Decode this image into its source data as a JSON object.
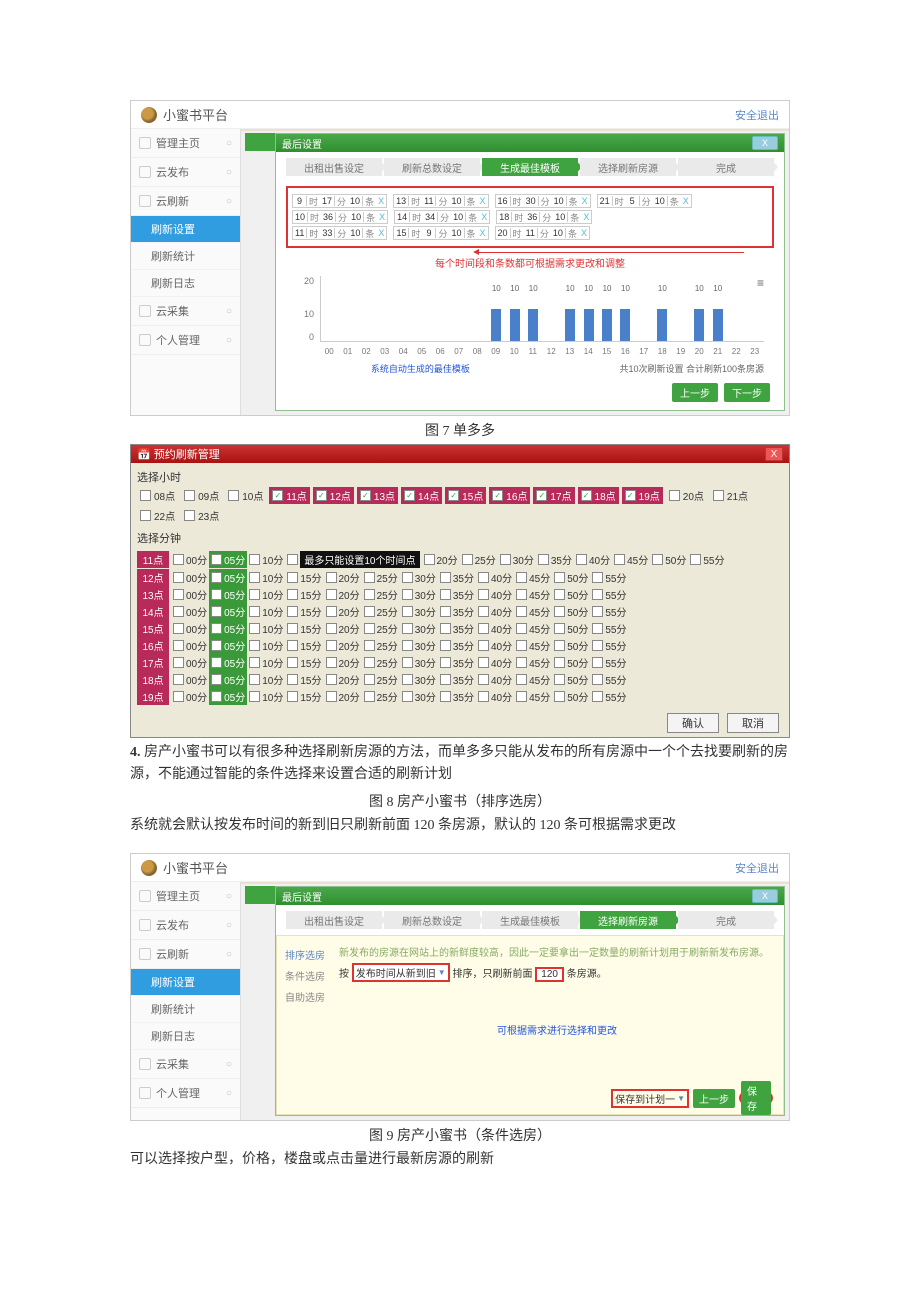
{
  "platform": {
    "name": "小蜜书平台",
    "safe_exit": "安全退出"
  },
  "sidebar": {
    "items": [
      {
        "label": "管理主页"
      },
      {
        "label": "云发布"
      },
      {
        "label": "云刷新"
      },
      {
        "label": "云采集"
      },
      {
        "label": "个人管理"
      }
    ],
    "sub": [
      "刷新设置",
      "刷新统计",
      "刷新日志"
    ]
  },
  "dialog1": {
    "title": "最后设置",
    "steps": [
      "出租出售设定",
      "刷新总数设定",
      "生成最佳模板",
      "选择刷新房源",
      "完成"
    ],
    "active_step": 2,
    "times": [
      [
        {
          "h": "9",
          "m": "17",
          "c": "10"
        },
        {
          "h": "13",
          "m": "11",
          "c": "10"
        },
        {
          "h": "16",
          "m": "30",
          "c": "10"
        },
        {
          "h": "21",
          "m": "5",
          "c": "10"
        }
      ],
      [
        {
          "h": "10",
          "m": "36",
          "c": "10"
        },
        {
          "h": "14",
          "m": "34",
          "c": "10"
        },
        {
          "h": "18",
          "m": "36",
          "c": "10"
        }
      ],
      [
        {
          "h": "11",
          "m": "33",
          "c": "10"
        },
        {
          "h": "15",
          "m": "9",
          "c": "10"
        },
        {
          "h": "20",
          "m": "11",
          "c": "10"
        }
      ]
    ],
    "time_unit": {
      "h": "时",
      "m": "分",
      "c": "条"
    },
    "anno": "每个时间段和条数都可根据需求更改和调整",
    "chart_anno": "系统自动生成的最佳模板",
    "summary": "共10次刷新设置 合计刷新100条房源",
    "prev": "上一步",
    "next": "下一步"
  },
  "chart_data": {
    "type": "bar",
    "categories": [
      "00",
      "01",
      "02",
      "03",
      "04",
      "05",
      "06",
      "07",
      "08",
      "09",
      "10",
      "11",
      "12",
      "13",
      "14",
      "15",
      "16",
      "17",
      "18",
      "19",
      "20",
      "21",
      "22",
      "23"
    ],
    "values": [
      0,
      0,
      0,
      0,
      0,
      0,
      0,
      0,
      0,
      10,
      10,
      10,
      0,
      10,
      10,
      10,
      10,
      0,
      10,
      0,
      10,
      10,
      0,
      0
    ],
    "ylim": [
      0,
      20
    ],
    "ylabel": "",
    "xlabel": "",
    "bar_label": "10"
  },
  "cap7": "图 7 单多多",
  "sched": {
    "title": "预约刷新管理",
    "hour_label": "选择小时",
    "hours": [
      {
        "t": "08点",
        "sel": false
      },
      {
        "t": "09点",
        "sel": false
      },
      {
        "t": "10点",
        "sel": false
      },
      {
        "t": "11点",
        "sel": true
      },
      {
        "t": "12点",
        "sel": true
      },
      {
        "t": "13点",
        "sel": true
      },
      {
        "t": "14点",
        "sel": true
      },
      {
        "t": "15点",
        "sel": true
      },
      {
        "t": "16点",
        "sel": true
      },
      {
        "t": "17点",
        "sel": true
      },
      {
        "t": "18点",
        "sel": true
      },
      {
        "t": "19点",
        "sel": true
      },
      {
        "t": "20点",
        "sel": false
      },
      {
        "t": "21点",
        "sel": false
      },
      {
        "t": "22点",
        "sel": false
      },
      {
        "t": "23点",
        "sel": false
      }
    ],
    "min_label": "选择分钟",
    "min_hours": [
      "11点",
      "12点",
      "13点",
      "14点",
      "15点",
      "16点",
      "17点",
      "18点",
      "19点"
    ],
    "min_opts": [
      "00分",
      "05分",
      "10分",
      "15分",
      "20分",
      "25分",
      "30分",
      "35分",
      "40分",
      "45分",
      "50分",
      "55分"
    ],
    "tip": "最多只能设置10个时间点",
    "ok": "确认",
    "cancel": "取消"
  },
  "para4": {
    "prefix": "4.",
    "text": " 房产小蜜书可以有很多种选择刷新房源的方法，而单多多只能从发布的所有房源中一个个去找要刷新的房源，不能通过智能的条件选择来设置合适的刷新计划"
  },
  "cap8": "图 8 房产小蜜书（排序选房）",
  "para8": "系统就会默认按发布时间的新到旧只刷新前面 120 条房源，默认的 120 条可根据需求更改",
  "dialog2": {
    "steps": [
      "出租出售设定",
      "刷新总数设定",
      "生成最佳模板",
      "选择刷新房源",
      "完成"
    ],
    "active_step": 3,
    "tabs": [
      "排序选房",
      "条件选房",
      "自助选房"
    ],
    "note": "新发布的房源在网站上的新鲜度较高，因此一定要拿出一定数量的刷新计划用于刷新新发布房源。",
    "line2": {
      "pre": "按",
      "sel": "发布时间从新到旧",
      "mid": "排序，只刷新前面",
      "val": "120",
      "suf": "条房源。"
    },
    "blue": "可根据需求进行选择和更改",
    "save_plan": "保存到计划一",
    "prev": "上一步",
    "save": "保存"
  },
  "cap9": "图 9 房产小蜜书（条件选房）",
  "para9": "可以选择按户型，价格，楼盘或点击量进行最新房源的刷新"
}
